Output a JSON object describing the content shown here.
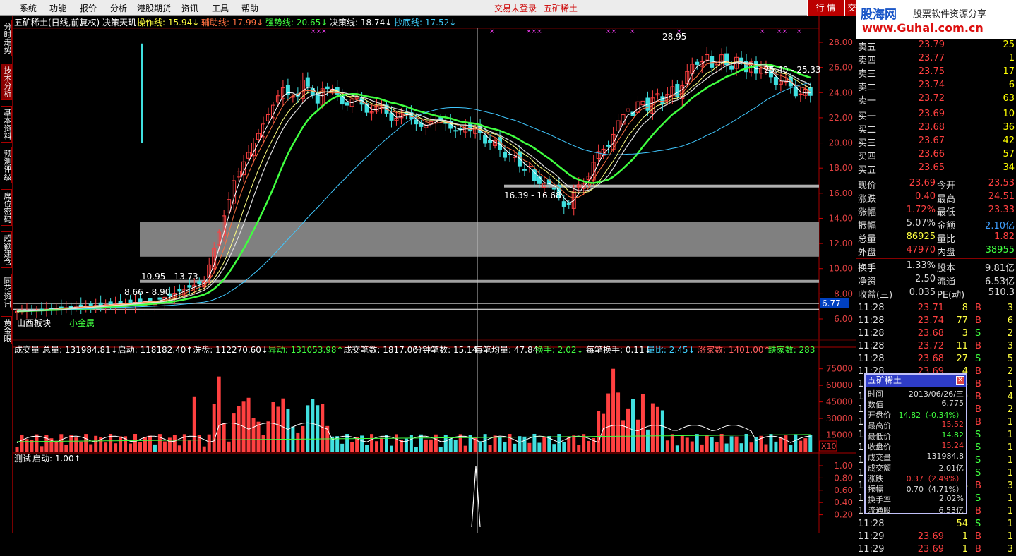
{
  "menu": [
    "系统",
    "功能",
    "报价",
    "分析",
    "港股期货",
    "资讯",
    "工具",
    "帮助"
  ],
  "status": {
    "login": "交易未登录",
    "stock": "五矿稀土"
  },
  "right_tabs": [
    "行 情",
    "交"
  ],
  "brand": {
    "cn": "股海网",
    "sub": "股票软件资源分享",
    "url": "www.Guhai.com.cn"
  },
  "sidebar_tabs": [
    "分时走势",
    "技术分析",
    "基本资料",
    "预测评级",
    "席位密码",
    "超额建仓",
    "同花资讯",
    "黄金眼"
  ],
  "chart_header": {
    "title": "五矿稀土(日线,前复权) 决策天玑",
    "items": [
      {
        "label": "操作线:",
        "value": "15.94",
        "arrow": "↓",
        "color": "#ffff40"
      },
      {
        "label": "辅助线:",
        "value": "17.99",
        "arrow": "↓",
        "color": "#ff7040"
      },
      {
        "label": "强势线:",
        "value": "20.65",
        "arrow": "↓",
        "color": "#40ff40"
      },
      {
        "label": "决策线:",
        "value": "18.74",
        "arrow": "↓",
        "color": "#ffffff"
      },
      {
        "label": "抄底线:",
        "value": "17.52",
        "arrow": "↓",
        "color": "#40d0ff"
      }
    ]
  },
  "price_axis": [
    "28.00",
    "26.00",
    "24.00",
    "22.00",
    "20.00",
    "18.00",
    "16.00",
    "14.00",
    "12.00",
    "10.00",
    "8.00",
    "6.00"
  ],
  "current_price_tag": "6.77",
  "annotations": {
    "high": "28.95",
    "range_upper": "25.40 - 25.33",
    "range_mid": "16.39 - 16.68",
    "range_low1": "10.95 - 13.73",
    "range_low2": "8.66 - 8.90",
    "marker": "×"
  },
  "bottom_labels": {
    "sector": "山西板块",
    "concept": "小金属"
  },
  "volume_header": {
    "title": "成交量",
    "items": [
      {
        "label": "总量:",
        "value": "131984.81",
        "arrow": "↓",
        "color": "#ffffff"
      },
      {
        "label": "启动:",
        "value": "118182.40",
        "arrow": "↑",
        "color": "#ffffff"
      },
      {
        "label": "洗盘:",
        "value": "112270.60",
        "arrow": "↓",
        "color": "#ffffff"
      },
      {
        "label": "异动:",
        "value": "131053.98",
        "arrow": "↑",
        "color": "#40ff40"
      },
      {
        "label": "成交笔数:",
        "value": "1817.00",
        "arrow": "",
        "color": "#ffffff"
      },
      {
        "label": "分钟笔数:",
        "value": "15.14",
        "arrow": "",
        "color": "#ffffff"
      },
      {
        "label": "每笔均量:",
        "value": "47.84",
        "arrow": "",
        "color": "#ffffff"
      },
      {
        "label": "换手:",
        "value": "2.02",
        "arrow": "↓",
        "color": "#40ff40"
      },
      {
        "label": "每笔换手:",
        "value": "0.11",
        "arrow": "↓",
        "color": "#ffffff"
      },
      {
        "label": "量比:",
        "value": "2.45",
        "arrow": "↓",
        "color": "#40d0ff"
      },
      {
        "label": "涨家数:",
        "value": "1401.00",
        "arrow": "↑",
        "color": "#ff6060"
      },
      {
        "label": "跌家数:",
        "value": "283",
        "arrow": "",
        "color": "#40ff40"
      }
    ]
  },
  "volume_axis": [
    "75000",
    "60000",
    "45000",
    "30000",
    "15000"
  ],
  "volume_unit": "X10",
  "test_header": {
    "title": "测试",
    "label": "启动:",
    "value": "1.00",
    "arrow": "↑"
  },
  "test_axis": [
    "1.00",
    "0.80",
    "0.60",
    "0.40",
    "0.20"
  ],
  "order_book": {
    "asks": [
      {
        "label": "卖五",
        "price": "23.79",
        "vol": "25"
      },
      {
        "label": "卖四",
        "price": "23.77",
        "vol": "1"
      },
      {
        "label": "卖三",
        "price": "23.75",
        "vol": "17"
      },
      {
        "label": "卖二",
        "price": "23.74",
        "vol": "6"
      },
      {
        "label": "卖一",
        "price": "23.72",
        "vol": "63"
      }
    ],
    "bids": [
      {
        "label": "买一",
        "price": "23.69",
        "vol": "10"
      },
      {
        "label": "买二",
        "price": "23.68",
        "vol": "36"
      },
      {
        "label": "买三",
        "price": "23.67",
        "vol": "42"
      },
      {
        "label": "买四",
        "price": "23.66",
        "vol": "57"
      },
      {
        "label": "买五",
        "price": "23.65",
        "vol": "34"
      }
    ]
  },
  "stats": [
    [
      {
        "label": "现价",
        "value": "23.69",
        "color": "#ff4040"
      },
      {
        "label": "今开",
        "value": "23.53",
        "color": "#ff4040"
      }
    ],
    [
      {
        "label": "涨跌",
        "value": "0.40",
        "color": "#ff4040"
      },
      {
        "label": "最高",
        "value": "24.51",
        "color": "#ff4040"
      }
    ],
    [
      {
        "label": "涨幅",
        "value": "1.72%",
        "color": "#ff4040"
      },
      {
        "label": "最低",
        "value": "23.33",
        "color": "#ff4040"
      }
    ],
    [
      {
        "label": "振幅",
        "value": "5.07%",
        "color": "#dddddd"
      },
      {
        "label": "金额",
        "value": "2.10亿",
        "color": "#40a0ff"
      }
    ],
    [
      {
        "label": "总量",
        "value": "86925",
        "color": "#ffff40"
      },
      {
        "label": "量比",
        "value": "1.82",
        "color": "#ff4040"
      }
    ],
    [
      {
        "label": "外盘",
        "value": "47970",
        "color": "#ff4040"
      },
      {
        "label": "内盘",
        "value": "38955",
        "color": "#40ff40"
      }
    ],
    [
      {
        "label": "换手",
        "value": "1.33%",
        "color": "#dddddd"
      },
      {
        "label": "股本",
        "value": "9.81亿",
        "color": "#dddddd"
      }
    ],
    [
      {
        "label": "净资",
        "value": "2.50",
        "color": "#dddddd"
      },
      {
        "label": "流通",
        "value": "6.53亿",
        "color": "#dddddd"
      }
    ],
    [
      {
        "label": "收益(三)",
        "value": "0.035",
        "color": "#dddddd"
      },
      {
        "label": "PE(动)",
        "value": "510.3",
        "color": "#dddddd"
      }
    ]
  ],
  "ticks": [
    {
      "time": "11:28",
      "price": "23.71",
      "vol": "8",
      "side": "B",
      "n": "3"
    },
    {
      "time": "11:28",
      "price": "23.74",
      "vol": "77",
      "side": "B",
      "n": "6"
    },
    {
      "time": "11:28",
      "price": "23.68",
      "vol": "3",
      "side": "S",
      "n": "2"
    },
    {
      "time": "11:28",
      "price": "23.72",
      "vol": "11",
      "side": "B",
      "n": "3"
    },
    {
      "time": "11:28",
      "price": "23.68",
      "vol": "27",
      "side": "S",
      "n": "5"
    },
    {
      "time": "11:28",
      "price": "23.69",
      "vol": "4",
      "side": "B",
      "n": "2"
    },
    {
      "time": "11:28",
      "price": "",
      "vol": "6",
      "side": "B",
      "n": "1"
    },
    {
      "time": "11:28",
      "price": "",
      "vol": "0",
      "side": "B",
      "n": "4"
    },
    {
      "time": "11:28",
      "price": "",
      "vol": "2",
      "side": "B",
      "n": "2"
    },
    {
      "time": "11:28",
      "price": "",
      "vol": "1",
      "side": "B",
      "n": "1"
    },
    {
      "time": "11:28",
      "price": "",
      "vol": "5",
      "side": "S",
      "n": "1"
    },
    {
      "time": "11:28",
      "price": "",
      "vol": "5",
      "side": "S",
      "n": "1"
    },
    {
      "time": "11:28",
      "price": "",
      "vol": "5",
      "side": "S",
      "n": "1"
    },
    {
      "time": "11:28",
      "price": "",
      "vol": "5",
      "side": "S",
      "n": "1"
    },
    {
      "time": "11:28",
      "price": "",
      "vol": "4",
      "side": "B",
      "n": "3"
    },
    {
      "time": "11:28",
      "price": "",
      "vol": "1",
      "side": "S",
      "n": "1"
    },
    {
      "time": "11:28",
      "price": "",
      "vol": "1",
      "side": "B",
      "n": "1"
    },
    {
      "time": "11:28",
      "price": "",
      "vol": "54",
      "side": "S",
      "n": "1"
    },
    {
      "time": "11:29",
      "price": "23.69",
      "vol": "1",
      "side": "B",
      "n": "1"
    },
    {
      "time": "11:29",
      "price": "23.69",
      "vol": "1",
      "side": "B",
      "n": "3"
    }
  ],
  "popup": {
    "title": "五矿稀土",
    "rows": [
      {
        "label": "时间",
        "value": "2013/06/26/三",
        "color": "#dddddd"
      },
      {
        "label": "数值",
        "value": "6.775",
        "color": "#dddddd"
      },
      {
        "label": "开盘价",
        "value": "14.82（-0.34%）",
        "color": "#40ff40"
      },
      {
        "label": "最高价",
        "value": "15.52",
        "color": "#ff4040"
      },
      {
        "label": "最低价",
        "value": "14.82",
        "color": "#40ff40"
      },
      {
        "label": "收盘价",
        "value": "15.24",
        "color": "#ff4040"
      },
      {
        "label": "成交量",
        "value": "131984.8",
        "color": "#dddddd"
      },
      {
        "label": "成交额",
        "value": "2.01亿",
        "color": "#dddddd"
      },
      {
        "label": "涨跌",
        "value": "0.37（2.49%）",
        "color": "#ff4040"
      },
      {
        "label": "振幅",
        "value": "0.70（4.71%）",
        "color": "#dddddd"
      },
      {
        "label": "换手率",
        "value": "2.02%",
        "color": "#dddddd"
      },
      {
        "label": "流通股",
        "value": "6.53亿",
        "color": "#dddddd"
      }
    ]
  },
  "colors": {
    "up": "#ff4040",
    "down": "#40e0e0",
    "grid": "#700000",
    "bg": "#000000"
  }
}
